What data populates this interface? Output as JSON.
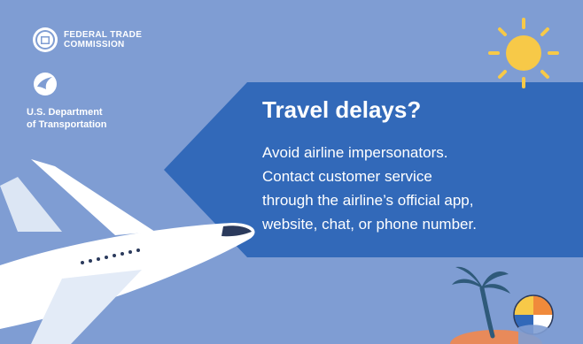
{
  "logos": {
    "ftc_lines": [
      "FEDERAL TRADE",
      "COMMISSION"
    ],
    "dot_lines": [
      "U.S. Department",
      "of Transportation"
    ]
  },
  "message": {
    "headline": "Travel delays?",
    "body_lines": [
      "Avoid airline impersonators.",
      "Contact customer service",
      "through the airline’s official app,",
      "website, chat, or phone number."
    ]
  },
  "illustrations": {
    "icons": [
      "sun-icon",
      "airplane-icon",
      "palm-tree-icon",
      "beach-ball-icon",
      "island-icon"
    ]
  },
  "colors": {
    "background": "#7f9dd3",
    "banner": "#3269b9",
    "text": "#ffffff",
    "sun": "#f7c948",
    "beach_ball_orange": "#f08a3b",
    "island": "#e88a5a"
  }
}
